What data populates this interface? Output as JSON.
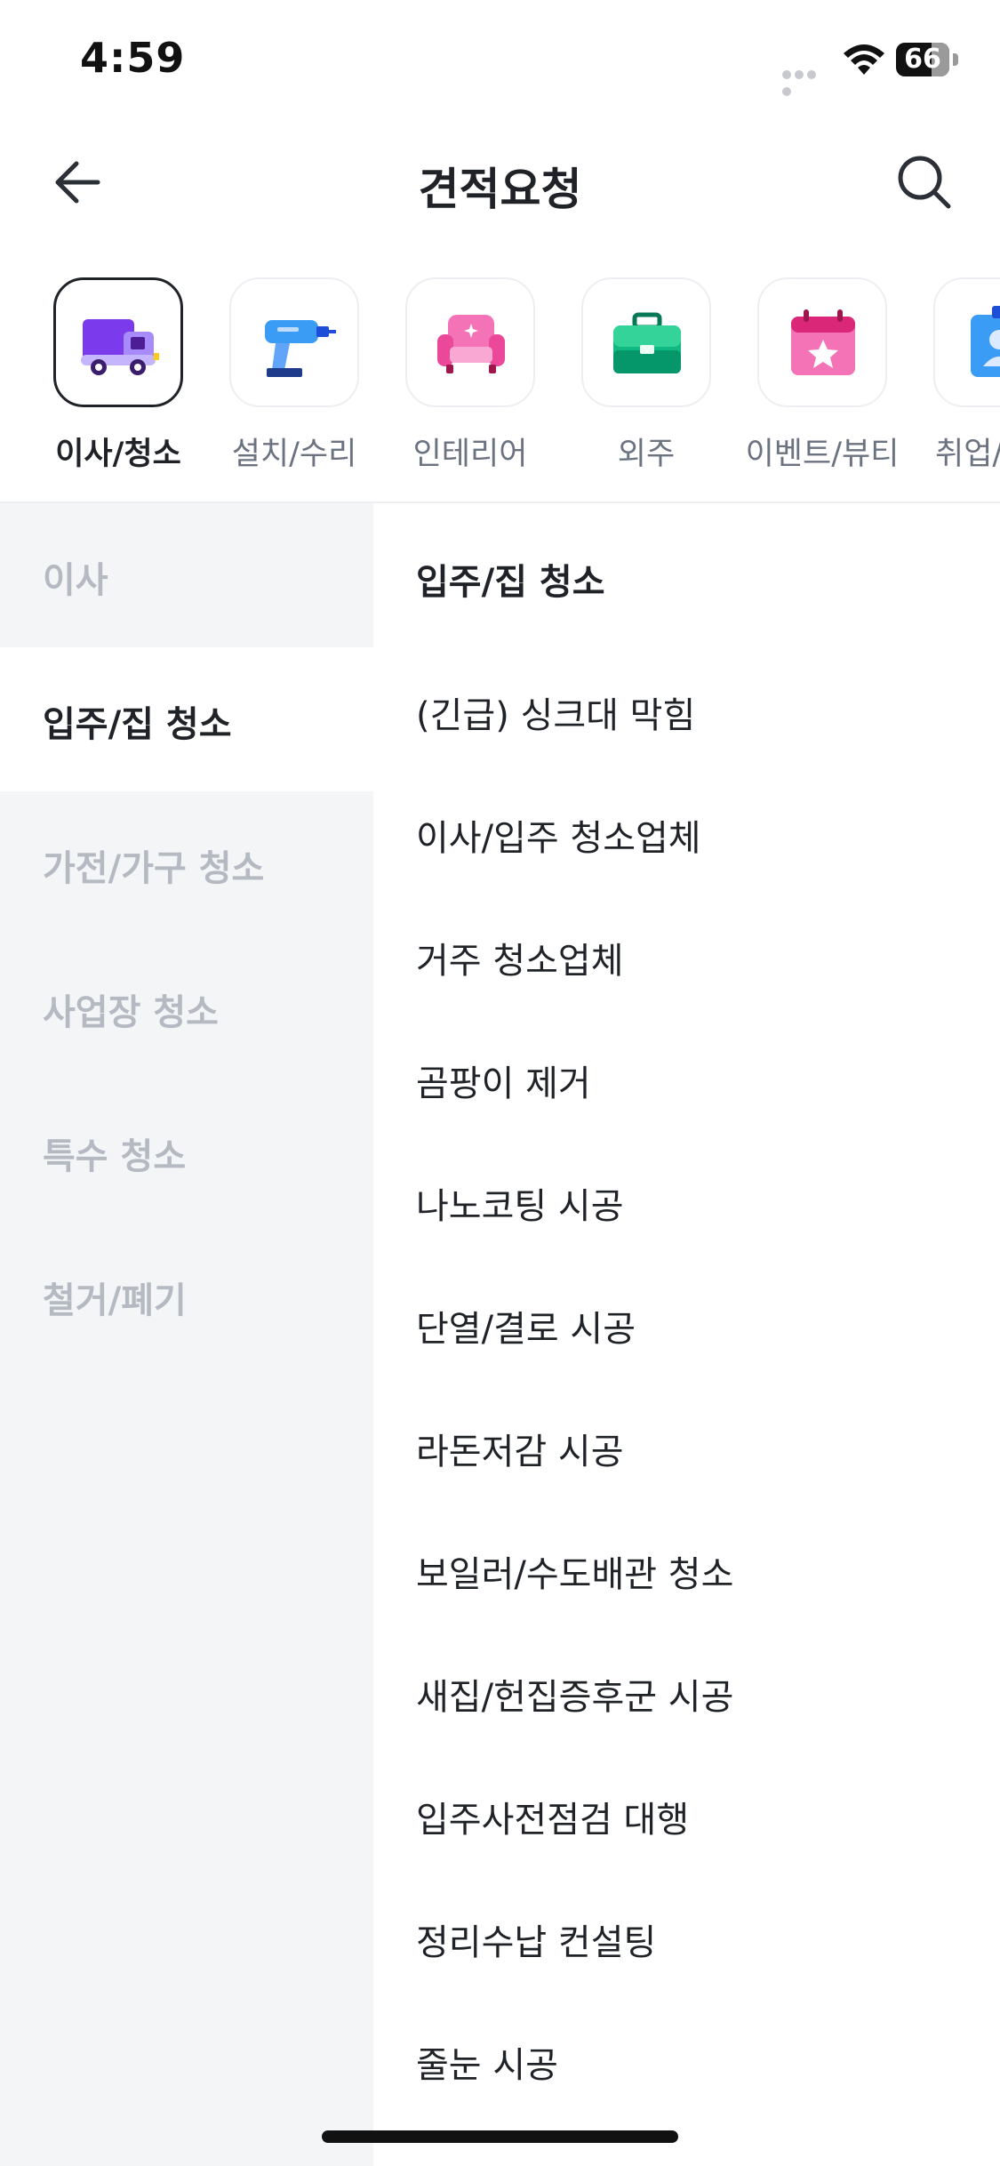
{
  "status_bar": {
    "time": "4:59",
    "battery_level": "66"
  },
  "header": {
    "title": "견적요청",
    "back_icon": "arrow-left-icon",
    "search_icon": "search-icon"
  },
  "categories": [
    {
      "label": "이사/청소",
      "icon": "truck-icon",
      "active": true,
      "color": "#7c3aed"
    },
    {
      "label": "설치/수리",
      "icon": "drill-icon",
      "active": false,
      "color": "#3b9cf6"
    },
    {
      "label": "인테리어",
      "icon": "armchair-icon",
      "active": false,
      "color": "#ec4899"
    },
    {
      "label": "외주",
      "icon": "briefcase-icon",
      "active": false,
      "color": "#10b981"
    },
    {
      "label": "이벤트/뷰티",
      "icon": "calendar-star-icon",
      "active": false,
      "color": "#ec4899"
    },
    {
      "label": "취업/",
      "icon": "id-badge-icon",
      "active": false,
      "color": "#3b9cf6"
    }
  ],
  "sidebar": {
    "items": [
      {
        "label": "이사",
        "active": false
      },
      {
        "label": "입주/집 청소",
        "active": true
      },
      {
        "label": "가전/가구 청소",
        "active": false
      },
      {
        "label": "사업장 청소",
        "active": false
      },
      {
        "label": "특수 청소",
        "active": false
      },
      {
        "label": "철거/폐기",
        "active": false
      }
    ]
  },
  "list": {
    "title": "입주/집 청소",
    "items": [
      "(긴급) 싱크대 막힘",
      "이사/입주 청소업체",
      "거주 청소업체",
      "곰팡이 제거",
      "나노코팅 시공",
      "단열/결로 시공",
      "라돈저감 시공",
      "보일러/수도배관 청소",
      "새집/헌집증후군 시공",
      "입주사전점검 대행",
      "정리수납 컨설팅",
      "줄눈 시공"
    ]
  }
}
